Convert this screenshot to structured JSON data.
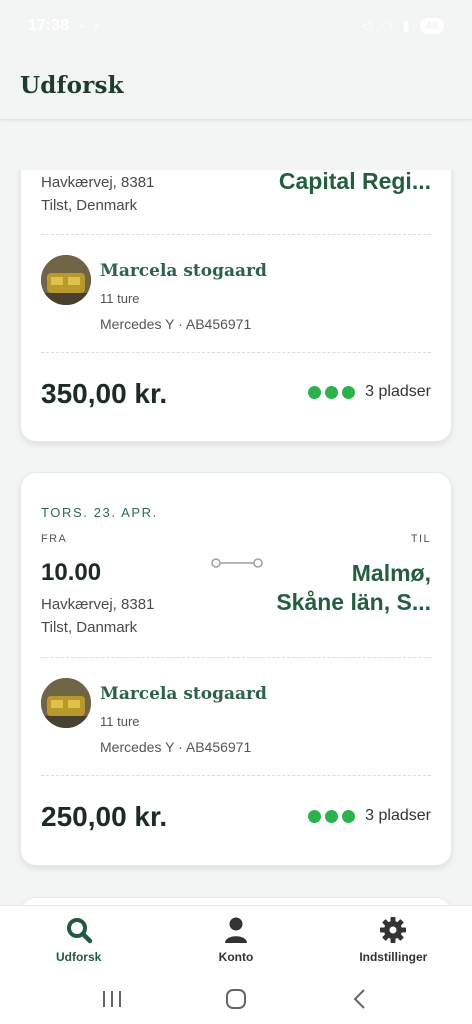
{
  "status_bar": {
    "time": "17:38",
    "battery": "48"
  },
  "header": {
    "title": "Udforsk"
  },
  "cards": [
    {
      "from_address": "Havkærvej, 8381\nTilst, Denmark",
      "destination": "Capital Regi...",
      "driver": {
        "name": "Marcela stogaard",
        "trips": "11 ture",
        "car": "Mercedes Y · AB456971"
      },
      "price": "350,00 kr.",
      "seats_label": "3 pladser",
      "seats_count": 3
    },
    {
      "date": "TORS. 23. APR.",
      "from_label": "FRA",
      "to_label": "TIL",
      "time": "10.00",
      "from_address": "Havkærvej, 8381\nTilst, Danmark",
      "destination": "Malmø,\nSkåne län, S...",
      "driver": {
        "name": "Marcela stogaard",
        "trips": "11 ture",
        "car": "Mercedes Y · AB456971"
      },
      "price": "250,00 kr.",
      "seats_label": "3 pladser",
      "seats_count": 3
    }
  ],
  "bottom_nav": [
    {
      "label": "Udforsk",
      "icon": "search-icon",
      "active": true
    },
    {
      "label": "Konto",
      "icon": "user-icon",
      "active": false
    },
    {
      "label": "Indstillinger",
      "icon": "gear-icon",
      "active": false
    }
  ],
  "colors": {
    "accent": "#1f5b3c",
    "seat_dot": "#2bb24c",
    "background": "#f3f5f4"
  }
}
